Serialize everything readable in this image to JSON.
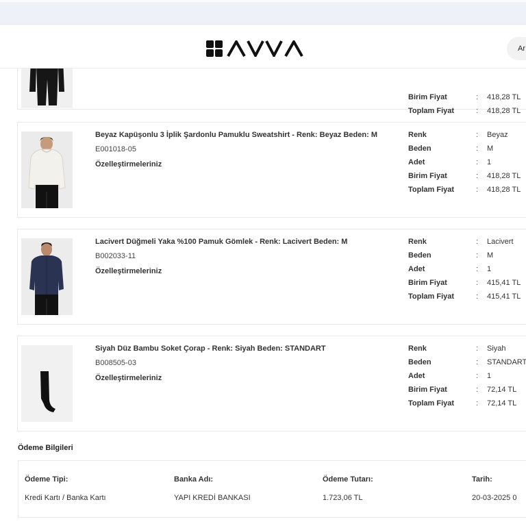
{
  "header": {
    "brand": "AVVA",
    "pill_text": "Ar"
  },
  "items": [
    {
      "name": "",
      "code": "",
      "customizations_label": "",
      "attributes": [
        {
          "label": "Birim Fiyat",
          "value": "418,28 TL"
        },
        {
          "label": "Toplam Fiyat",
          "value": "418,28 TL"
        }
      ]
    },
    {
      "name": "Beyaz Kapüşonlu 3 İplik Şardonlu Pamuklu Sweatshirt - Renk: Beyaz Beden: M",
      "code": "E001018-05",
      "customizations_label": "Özelleştirmeleriniz",
      "attributes": [
        {
          "label": "Renk",
          "value": "Beyaz"
        },
        {
          "label": "Beden",
          "value": "M"
        },
        {
          "label": "Adet",
          "value": "1"
        },
        {
          "label": "Birim Fiyat",
          "value": "418,28 TL"
        },
        {
          "label": "Toplam Fiyat",
          "value": "418,28 TL"
        }
      ]
    },
    {
      "name": "Lacivert Düğmeli Yaka %100 Pamuk Gömlek - Renk: Lacivert Beden: M",
      "code": "B002033-11",
      "customizations_label": "Özelleştirmeleriniz",
      "attributes": [
        {
          "label": "Renk",
          "value": "Lacivert"
        },
        {
          "label": "Beden",
          "value": "M"
        },
        {
          "label": "Adet",
          "value": "1"
        },
        {
          "label": "Birim Fiyat",
          "value": "415,41 TL"
        },
        {
          "label": "Toplam Fiyat",
          "value": "415,41 TL"
        }
      ]
    },
    {
      "name": "Siyah Düz Bambu Soket Çorap - Renk: Siyah Beden: STANDART",
      "code": "B008505-03",
      "customizations_label": "Özelleştirmeleriniz",
      "attributes": [
        {
          "label": "Renk",
          "value": "Siyah"
        },
        {
          "label": "Beden",
          "value": "STANDART"
        },
        {
          "label": "Adet",
          "value": "1"
        },
        {
          "label": "Birim Fiyat",
          "value": "72,14 TL"
        },
        {
          "label": "Toplam Fiyat",
          "value": "72,14 TL"
        }
      ]
    }
  ],
  "attr_separator": ":",
  "payment": {
    "section_title": "Ödeme Bilgileri",
    "columns": [
      {
        "header": "Ödeme Tipi:",
        "value": "Kredi Kartı / Banka Kartı"
      },
      {
        "header": "Banka Adı:",
        "value": "YAPI KREDİ BANKASI"
      },
      {
        "header": "Ödeme Tutarı:",
        "value": "1.723,06 TL"
      },
      {
        "header": "Tarih:",
        "value": "20-03-2025 0"
      }
    ]
  },
  "icons": [
    "avva-logo-mark-icon"
  ],
  "colors": {
    "text": "#333333",
    "border": "#e8e8e8",
    "browser_strip": "#eef1f8"
  }
}
